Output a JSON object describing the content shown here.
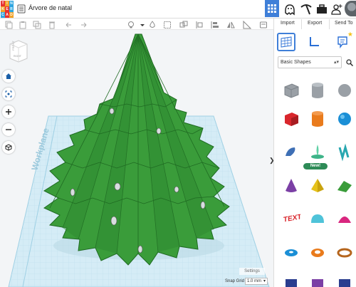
{
  "app": {
    "logo_letters": [
      "T",
      "I",
      "N",
      "K",
      "E",
      "R",
      "C",
      "A",
      "D"
    ],
    "logo_colors": [
      "#e8312f",
      "#f1a22a",
      "#2fa6e0",
      "#f1a22a",
      "#e8312f",
      "#2fa6e0",
      "#2fa6e0",
      "#e8312f",
      "#f1a22a"
    ],
    "document_title": "Árvore de natal",
    "accent": "#3f7fd8"
  },
  "topbar_icons": [
    "grid-view-icon",
    "ghost-sim-icon",
    "pickaxe-icon",
    "briefcase-icon",
    "add-user-icon",
    "avatar"
  ],
  "toolbar": {
    "icons": [
      "copy-icon",
      "paste-icon",
      "duplicate-icon",
      "delete-icon",
      "undo-icon",
      "redo-icon",
      "light-bulb-icon",
      "shape-color-icon",
      "hole-icon",
      "group-icon",
      "ungroup-icon",
      "align-icon",
      "flip-icon",
      "ruler-icon",
      "note-icon"
    ]
  },
  "panel": {
    "import_label": "Import",
    "export_label": "Export",
    "send_label": "Send To",
    "category": "Basic Shapes",
    "new_badge": "New!"
  },
  "shapes": [
    {
      "name": "box-hole-shape",
      "color": "#9aa0a6"
    },
    {
      "name": "cylinder-hole-shape",
      "color": "#9aa0a6"
    },
    {
      "name": "sphere-hole-shape",
      "color": "#9aa0a6"
    },
    {
      "name": "box-shape",
      "color": "#d9262c"
    },
    {
      "name": "cylinder-shape",
      "color": "#e97b1c"
    },
    {
      "name": "sphere-shape",
      "color": "#1b8fd6"
    },
    {
      "name": "scribble-shape",
      "color": "#3e6fb5"
    },
    {
      "name": "favorite-shape",
      "color": "#3eb489"
    },
    {
      "name": "text-shape-3d",
      "color": "#28a7b0"
    },
    {
      "name": "cone-shape",
      "color": "#7b3fa5"
    },
    {
      "name": "pyramid-shape",
      "color": "#e6c21a"
    },
    {
      "name": "roof-shape",
      "color": "#3a9c3a"
    },
    {
      "name": "text-shape",
      "color": "#d9262c"
    },
    {
      "name": "half-sphere-shape",
      "color": "#4fc3d9"
    },
    {
      "name": "paraboloid-shape",
      "color": "#d9267f"
    },
    {
      "name": "torus-shape",
      "color": "#1b8fd6"
    },
    {
      "name": "tube-shape",
      "color": "#e97b1c"
    },
    {
      "name": "ring-shape",
      "color": "#b5651d"
    }
  ],
  "viewport": {
    "cube_label": "RIGHT",
    "workplane_label": "Workplane",
    "settings_label": "Settings",
    "snap_grid_label": "Snap Grid",
    "snap_grid_value": "1.0 mm",
    "model_color": "#3a9c3a"
  }
}
